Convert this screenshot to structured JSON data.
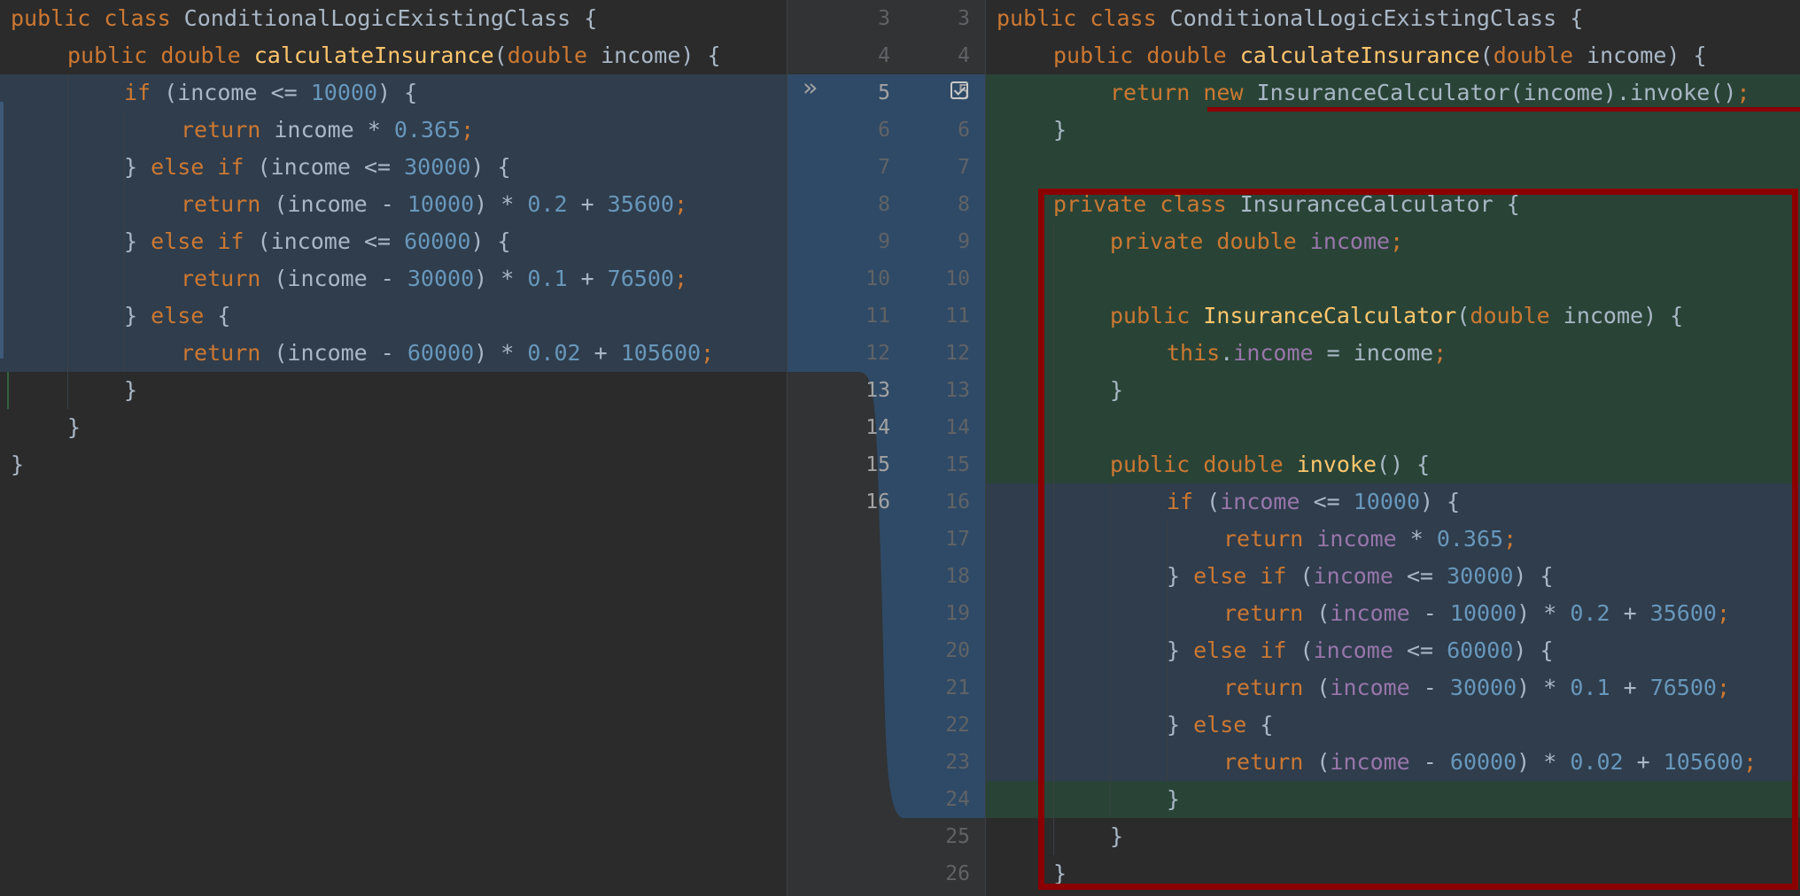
{
  "left_lines": [
    {
      "n": 3,
      "indent": 0,
      "tokens": [
        [
          "kw",
          "public "
        ],
        [
          "kw",
          "class "
        ],
        [
          "pl",
          "ConditionalLogicExistingClass {"
        ]
      ]
    },
    {
      "n": 4,
      "indent": 1,
      "tokens": [
        [
          "kw",
          "public "
        ],
        [
          "kw",
          "double "
        ],
        [
          "fn",
          "calculateInsurance"
        ],
        [
          "pl",
          "("
        ],
        [
          "kw",
          "double "
        ],
        [
          "pl",
          "income) {"
        ]
      ]
    },
    {
      "n": 5,
      "indent": 2,
      "tokens": [
        [
          "kw",
          "if "
        ],
        [
          "pl",
          "(income <= "
        ],
        [
          "num",
          "10000"
        ],
        [
          "pl",
          ") {"
        ]
      ]
    },
    {
      "n": 6,
      "indent": 3,
      "tokens": [
        [
          "kw",
          "return "
        ],
        [
          "pl",
          "income * "
        ],
        [
          "num",
          "0.365"
        ],
        [
          "kw",
          ";"
        ]
      ]
    },
    {
      "n": 7,
      "indent": 2,
      "tokens": [
        [
          "pl",
          "} "
        ],
        [
          "kw",
          "else if "
        ],
        [
          "pl",
          "(income <= "
        ],
        [
          "num",
          "30000"
        ],
        [
          "pl",
          ") {"
        ]
      ]
    },
    {
      "n": 8,
      "indent": 3,
      "tokens": [
        [
          "kw",
          "return "
        ],
        [
          "pl",
          "(income - "
        ],
        [
          "num",
          "10000"
        ],
        [
          "pl",
          ") * "
        ],
        [
          "num",
          "0.2"
        ],
        [
          "pl",
          " + "
        ],
        [
          "num",
          "35600"
        ],
        [
          "kw",
          ";"
        ]
      ]
    },
    {
      "n": 9,
      "indent": 2,
      "tokens": [
        [
          "pl",
          "} "
        ],
        [
          "kw",
          "else if "
        ],
        [
          "pl",
          "(income <= "
        ],
        [
          "num",
          "60000"
        ],
        [
          "pl",
          ") {"
        ]
      ]
    },
    {
      "n": 10,
      "indent": 3,
      "tokens": [
        [
          "kw",
          "return "
        ],
        [
          "pl",
          "(income - "
        ],
        [
          "num",
          "30000"
        ],
        [
          "pl",
          ") * "
        ],
        [
          "num",
          "0.1"
        ],
        [
          "pl",
          " + "
        ],
        [
          "num",
          "76500"
        ],
        [
          "kw",
          ";"
        ]
      ]
    },
    {
      "n": 11,
      "indent": 2,
      "tokens": [
        [
          "pl",
          "} "
        ],
        [
          "kw",
          "else "
        ],
        [
          "pl",
          "{"
        ]
      ]
    },
    {
      "n": 12,
      "indent": 3,
      "tokens": [
        [
          "kw",
          "return "
        ],
        [
          "pl",
          "(income - "
        ],
        [
          "num",
          "60000"
        ],
        [
          "pl",
          ") * "
        ],
        [
          "num",
          "0.02"
        ],
        [
          "pl",
          " + "
        ],
        [
          "num",
          "105600"
        ],
        [
          "kw",
          ";"
        ]
      ]
    },
    {
      "n": 13,
      "indent": 2,
      "tokens": [
        [
          "pl",
          "}"
        ]
      ]
    },
    {
      "n": 14,
      "indent": 1,
      "tokens": [
        [
          "pl",
          "}"
        ]
      ]
    },
    {
      "n": 15,
      "indent": 0,
      "tokens": [
        [
          "pl",
          "}"
        ]
      ]
    },
    {
      "n": 16,
      "indent": 0,
      "tokens": []
    }
  ],
  "right_lines": [
    {
      "n": 3,
      "indent": 0,
      "tokens": [
        [
          "kw",
          "public "
        ],
        [
          "kw",
          "class "
        ],
        [
          "pl",
          "ConditionalLogicExistingClass {"
        ]
      ]
    },
    {
      "n": 4,
      "indent": 1,
      "tokens": [
        [
          "kw",
          "public "
        ],
        [
          "kw",
          "double "
        ],
        [
          "fn",
          "calculateInsurance"
        ],
        [
          "pl",
          "("
        ],
        [
          "kw",
          "double "
        ],
        [
          "pl",
          "income) {"
        ]
      ]
    },
    {
      "n": 5,
      "indent": 2,
      "tokens": [
        [
          "kw",
          "return "
        ],
        [
          "kw",
          "new "
        ],
        [
          "pl",
          "InsuranceCalculator(income).invoke()"
        ],
        [
          "kw",
          ";"
        ]
      ]
    },
    {
      "n": 6,
      "indent": 1,
      "tokens": [
        [
          "pl",
          "}"
        ]
      ]
    },
    {
      "n": 7,
      "indent": 0,
      "tokens": []
    },
    {
      "n": 8,
      "indent": 1,
      "tokens": [
        [
          "kw",
          "private "
        ],
        [
          "kw",
          "class "
        ],
        [
          "pl",
          "InsuranceCalculator {"
        ]
      ]
    },
    {
      "n": 9,
      "indent": 2,
      "tokens": [
        [
          "kw",
          "private "
        ],
        [
          "kw",
          "double "
        ],
        [
          "fld",
          "income"
        ],
        [
          "kw",
          ";"
        ]
      ]
    },
    {
      "n": 10,
      "indent": 0,
      "tokens": []
    },
    {
      "n": 11,
      "indent": 2,
      "tokens": [
        [
          "kw",
          "public "
        ],
        [
          "fn",
          "InsuranceCalculator"
        ],
        [
          "pl",
          "("
        ],
        [
          "kw",
          "double "
        ],
        [
          "pl",
          "income) {"
        ]
      ]
    },
    {
      "n": 12,
      "indent": 3,
      "tokens": [
        [
          "kw",
          "this"
        ],
        [
          "pl",
          "."
        ],
        [
          "fld",
          "income"
        ],
        [
          "pl",
          " = income"
        ],
        [
          "kw",
          ";"
        ]
      ]
    },
    {
      "n": 13,
      "indent": 2,
      "tokens": [
        [
          "pl",
          "}"
        ]
      ]
    },
    {
      "n": 14,
      "indent": 0,
      "tokens": []
    },
    {
      "n": 15,
      "indent": 2,
      "tokens": [
        [
          "kw",
          "public "
        ],
        [
          "kw",
          "double "
        ],
        [
          "fn",
          "invoke"
        ],
        [
          "pl",
          "() {"
        ]
      ]
    },
    {
      "n": 16,
      "indent": 3,
      "tokens": [
        [
          "kw",
          "if "
        ],
        [
          "pl",
          "("
        ],
        [
          "fld",
          "income"
        ],
        [
          "pl",
          " <= "
        ],
        [
          "num",
          "10000"
        ],
        [
          "pl",
          ") {"
        ]
      ]
    },
    {
      "n": 17,
      "indent": 4,
      "tokens": [
        [
          "kw",
          "return "
        ],
        [
          "fld",
          "income"
        ],
        [
          "pl",
          " * "
        ],
        [
          "num",
          "0.365"
        ],
        [
          "kw",
          ";"
        ]
      ]
    },
    {
      "n": 18,
      "indent": 3,
      "tokens": [
        [
          "pl",
          "} "
        ],
        [
          "kw",
          "else if "
        ],
        [
          "pl",
          "("
        ],
        [
          "fld",
          "income"
        ],
        [
          "pl",
          " <= "
        ],
        [
          "num",
          "30000"
        ],
        [
          "pl",
          ") {"
        ]
      ]
    },
    {
      "n": 19,
      "indent": 4,
      "tokens": [
        [
          "kw",
          "return "
        ],
        [
          "pl",
          "("
        ],
        [
          "fld",
          "income"
        ],
        [
          "pl",
          " - "
        ],
        [
          "num",
          "10000"
        ],
        [
          "pl",
          ") * "
        ],
        [
          "num",
          "0.2"
        ],
        [
          "pl",
          " + "
        ],
        [
          "num",
          "35600"
        ],
        [
          "kw",
          ";"
        ]
      ]
    },
    {
      "n": 20,
      "indent": 3,
      "tokens": [
        [
          "pl",
          "} "
        ],
        [
          "kw",
          "else if "
        ],
        [
          "pl",
          "("
        ],
        [
          "fld",
          "income"
        ],
        [
          "pl",
          " <= "
        ],
        [
          "num",
          "60000"
        ],
        [
          "pl",
          ") {"
        ]
      ]
    },
    {
      "n": 21,
      "indent": 4,
      "tokens": [
        [
          "kw",
          "return "
        ],
        [
          "pl",
          "("
        ],
        [
          "fld",
          "income"
        ],
        [
          "pl",
          " - "
        ],
        [
          "num",
          "30000"
        ],
        [
          "pl",
          ") * "
        ],
        [
          "num",
          "0.1"
        ],
        [
          "pl",
          " + "
        ],
        [
          "num",
          "76500"
        ],
        [
          "kw",
          ";"
        ]
      ]
    },
    {
      "n": 22,
      "indent": 3,
      "tokens": [
        [
          "pl",
          "} "
        ],
        [
          "kw",
          "else "
        ],
        [
          "pl",
          "{"
        ]
      ]
    },
    {
      "n": 23,
      "indent": 4,
      "tokens": [
        [
          "kw",
          "return "
        ],
        [
          "pl",
          "("
        ],
        [
          "fld",
          "income"
        ],
        [
          "pl",
          " - "
        ],
        [
          "num",
          "60000"
        ],
        [
          "pl",
          ") * "
        ],
        [
          "num",
          "0.02"
        ],
        [
          "pl",
          " + "
        ],
        [
          "num",
          "105600"
        ],
        [
          "kw",
          ";"
        ]
      ]
    },
    {
      "n": 24,
      "indent": 3,
      "tokens": [
        [
          "pl",
          "}"
        ]
      ]
    },
    {
      "n": 25,
      "indent": 2,
      "tokens": [
        [
          "pl",
          "}"
        ]
      ]
    },
    {
      "n": 26,
      "indent": 1,
      "tokens": [
        [
          "pl",
          "}"
        ]
      ]
    }
  ],
  "colors": {
    "background": "#2b2b2b",
    "modified": "#2f3d4c",
    "inserted": "#294436",
    "annotation": "#8b0000",
    "gutter_highlight": "#2f4a66"
  }
}
